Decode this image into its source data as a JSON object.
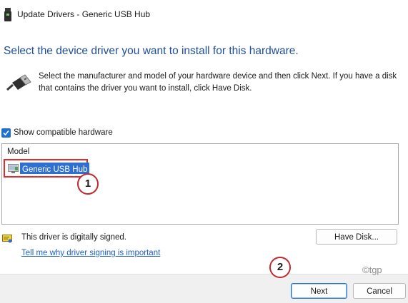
{
  "window": {
    "title": "Update Drivers - Generic USB Hub",
    "icon": "usb-device-icon"
  },
  "heading": "Select the device driver you want to install for this hardware.",
  "description": "Select the manufacturer and model of your hardware device and then click Next. If you have a disk that contains the driver you want to install, click Have Disk.",
  "show_compatible": {
    "label": "Show compatible hardware",
    "checked": true
  },
  "model_list": {
    "header": "Model",
    "items": [
      {
        "label": "Generic USB Hub",
        "selected": true,
        "icon": "device-icon"
      }
    ]
  },
  "annotations": {
    "marker1": "1",
    "marker2": "2",
    "marker_color": "#c0292e",
    "highlight_color": "#e52a2a"
  },
  "driver_status": {
    "signed_text": "This driver is digitally signed.",
    "link_text": "Tell me why driver signing is important",
    "icon": "signed-driver-icon"
  },
  "buttons": {
    "have_disk": "Have Disk...",
    "next": "Next",
    "cancel": "Cancel"
  },
  "watermark": "©tgp",
  "colors": {
    "heading": "#1f4e9c",
    "selection": "#2f6fd0",
    "link": "#1f5fc0",
    "primary_button_border": "#1f6fd0"
  }
}
